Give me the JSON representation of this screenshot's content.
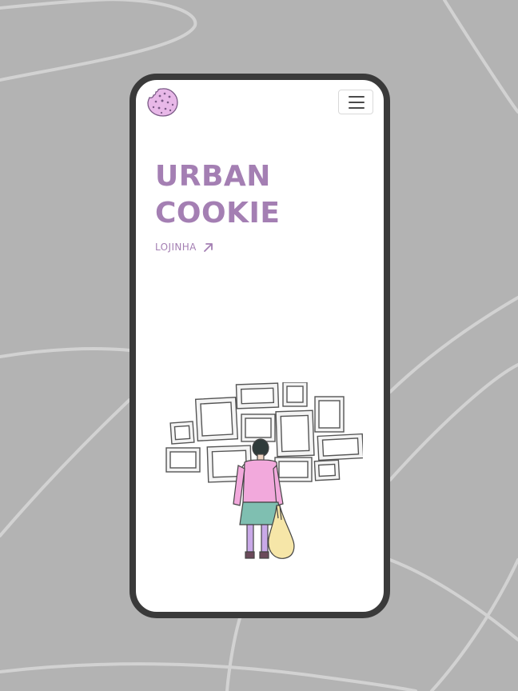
{
  "brand": {
    "title_line1": "URBAN",
    "title_line2": "COOKIE",
    "logo_icon": "cookie-icon"
  },
  "nav": {
    "menu_icon": "hamburger-menu-icon",
    "shop_link_label": "LOJINHA",
    "shop_link_icon": "arrow-up-right-icon"
  },
  "hero": {
    "illustration": "person-looking-at-picture-frames"
  },
  "colors": {
    "background": "#b3b3b3",
    "accent": "#a47fb3",
    "frame": "#3a3a3a",
    "logo_fill": "#e8b8e8"
  }
}
